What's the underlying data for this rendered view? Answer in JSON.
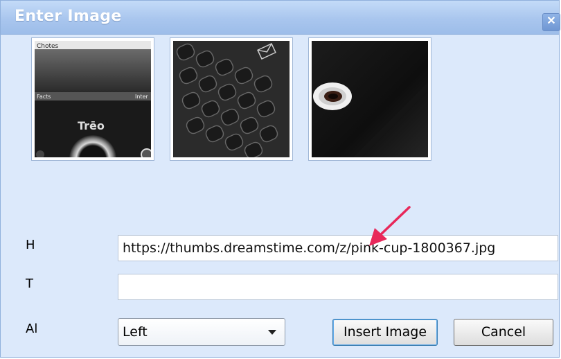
{
  "dialog": {
    "title": "Enter Image",
    "close_glyph": "✕"
  },
  "thumbnails": [
    {
      "name": "phone-screen-thumbnail",
      "text_top": "Chotes",
      "text_left": "Facts",
      "text_right": "Inter",
      "text_center": "Trēo"
    },
    {
      "name": "phone-keyboard-thumbnail"
    },
    {
      "name": "phone-camera-thumbnail"
    }
  ],
  "form": {
    "href_label": "H",
    "href_value": "https://thumbs.dreamstime.com/z/pink-cup-1800367.jpg",
    "title_label": "T",
    "title_value": "",
    "align_label": "Al",
    "align_value": "Left"
  },
  "buttons": {
    "insert_label": "Insert Image",
    "cancel_label": "Cancel"
  },
  "colors": {
    "dialog_bg": "#dce9fb",
    "titlebar": "#a9c6ee",
    "annotation_arrow": "#e8285a"
  },
  "icons": [
    "close-icon",
    "chevron-down-icon",
    "pointer-arrow-annotation"
  ]
}
